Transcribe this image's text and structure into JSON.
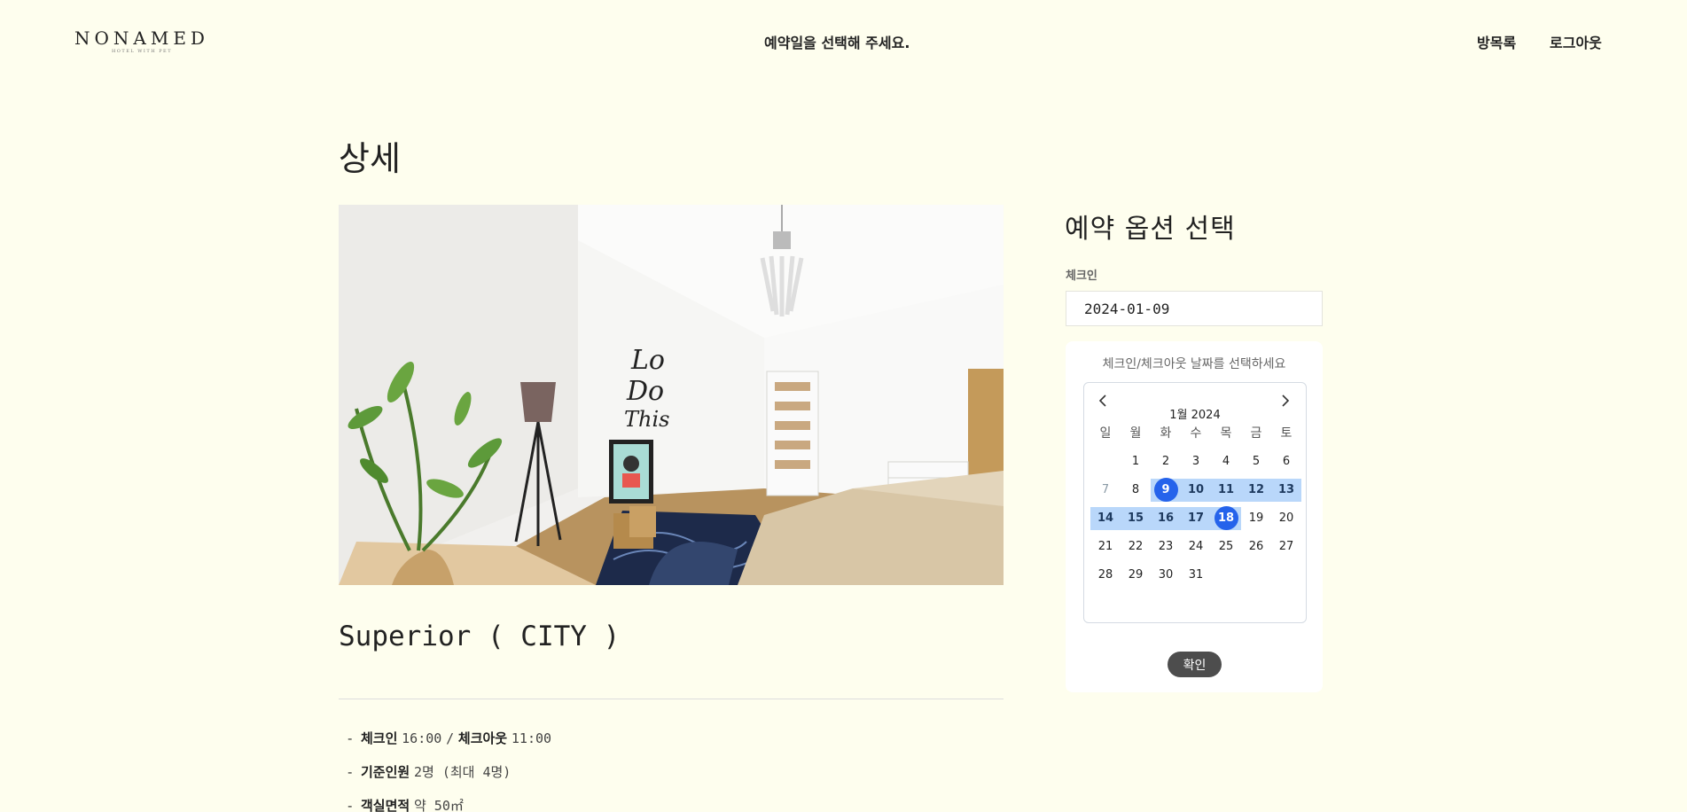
{
  "header": {
    "logo_main": "NONAMED",
    "logo_sub": "HOTEL WITH PET",
    "message": "예약일을 선택해 주세요.",
    "nav_rooms": "방목록",
    "nav_logout": "로그아웃"
  },
  "page": {
    "title": "상세"
  },
  "room": {
    "name": "Superior ( CITY )",
    "info": [
      {
        "bullet": "-",
        "label": "체크인",
        "value": "16:00",
        "sep": "/",
        "label2": "체크아웃",
        "value2": "11:00"
      },
      {
        "bullet": "-",
        "label": "기준인원",
        "value": "2명 (최대 4명)"
      },
      {
        "bullet": "-",
        "label": "객실면적",
        "value": "약 50㎡"
      }
    ]
  },
  "booking": {
    "title": "예약 옵션 선택",
    "checkin_label": "체크인",
    "checkin_value": "2024-01-09",
    "hint": "체크인/체크아웃 날짜를 선택하세요",
    "confirm_label": "확인",
    "calendar": {
      "month_label": "1월 2024",
      "weekdays": [
        "일",
        "월",
        "화",
        "수",
        "목",
        "금",
        "토"
      ],
      "weeks": [
        [
          "",
          "1",
          "2",
          "3",
          "4",
          "5",
          "6"
        ],
        [
          "7",
          "8",
          "9",
          "10",
          "11",
          "12",
          "13"
        ],
        [
          "14",
          "15",
          "16",
          "17",
          "18",
          "19",
          "20"
        ],
        [
          "21",
          "22",
          "23",
          "24",
          "25",
          "26",
          "27"
        ],
        [
          "28",
          "29",
          "30",
          "31",
          "",
          "",
          ""
        ]
      ],
      "selected_start": 9,
      "selected_end": 18,
      "disabled_days": [
        7
      ],
      "accent_color": "#2563eb",
      "range_color": "#b9d7fa"
    }
  },
  "icons": {
    "prev": "chevron-left-icon",
    "next": "chevron-right-icon"
  }
}
